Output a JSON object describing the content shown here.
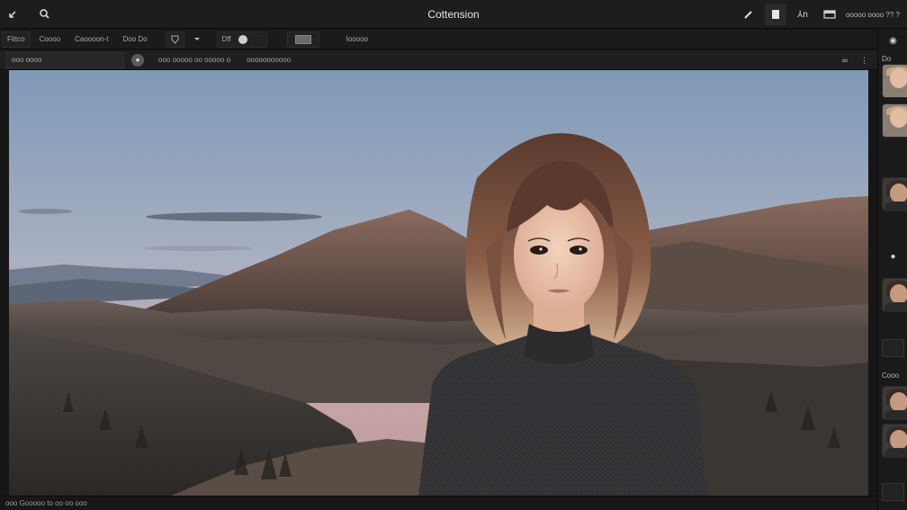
{
  "titlebar": {
    "title": "Cottension",
    "right_label": "ooooo oooo ?? ?",
    "btn_letters": "⅄n"
  },
  "toolbar": {
    "items": [
      "Fittco",
      "Coooo",
      "Caoooon-t",
      "Doo Do",
      "Dff"
    ],
    "zoom_label": "Iooooo"
  },
  "viewer": {
    "tab_label": "ooo oooo",
    "info": "ooo ooooo oo ooooo o",
    "info2": "ooooooooooo"
  },
  "status": {
    "text": "ooo  Gooooo to oo oo ooo"
  },
  "strip": {
    "label_top": "Do",
    "label_mid": "Cooo"
  },
  "colors": {
    "sky_top": "#7f99b8",
    "sky_bottom": "#c8a6a8",
    "accent_bg": "#1d1d1d"
  }
}
